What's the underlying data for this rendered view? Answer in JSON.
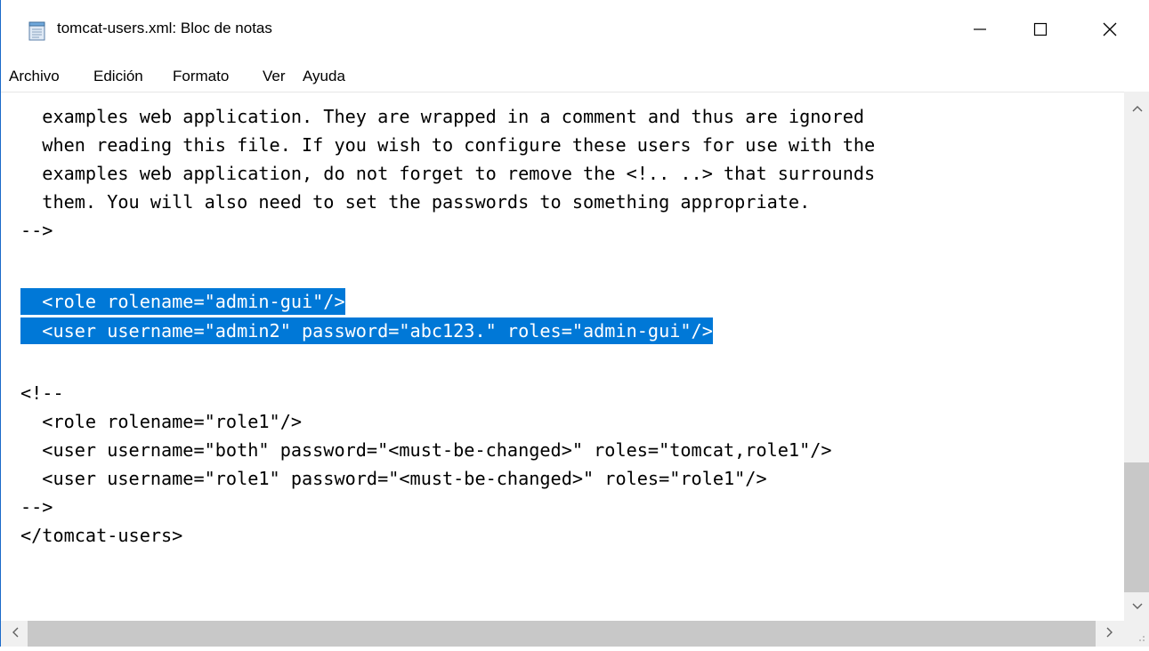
{
  "window": {
    "title": "tomcat-users.xml: Bloc de notas"
  },
  "menu": {
    "items": [
      "Archivo",
      "Edición",
      "Formato",
      "Ver",
      "Ayuda"
    ]
  },
  "editor": {
    "lines": [
      "  examples web application. They are wrapped in a comment and thus are ignored",
      "  when reading this file. If you wish to configure these users for use with the",
      "  examples web application, do not forget to remove the <!.. ..> that surrounds",
      "  them. You will also need to set the passwords to something appropriate.",
      "-->",
      "",
      "  <role rolename=\"admin-gui\"/>",
      "  <user username=\"admin2\" password=\"abc123.\" roles=\"admin-gui\"/>",
      "",
      "<!--",
      "  <role rolename=\"role1\"/>",
      "  <user username=\"both\" password=\"<must-be-changed>\" roles=\"tomcat,role1\"/>",
      "  <user username=\"role1\" password=\"<must-be-changed>\" roles=\"role1\"/>",
      "-->",
      "</tomcat-users>"
    ],
    "selected_line_indices": [
      6,
      7
    ],
    "selection_color": "#0078d7"
  },
  "icons": {
    "app": "notepad-icon",
    "minimize": "minimize-icon",
    "maximize": "maximize-icon",
    "close": "close-icon"
  }
}
